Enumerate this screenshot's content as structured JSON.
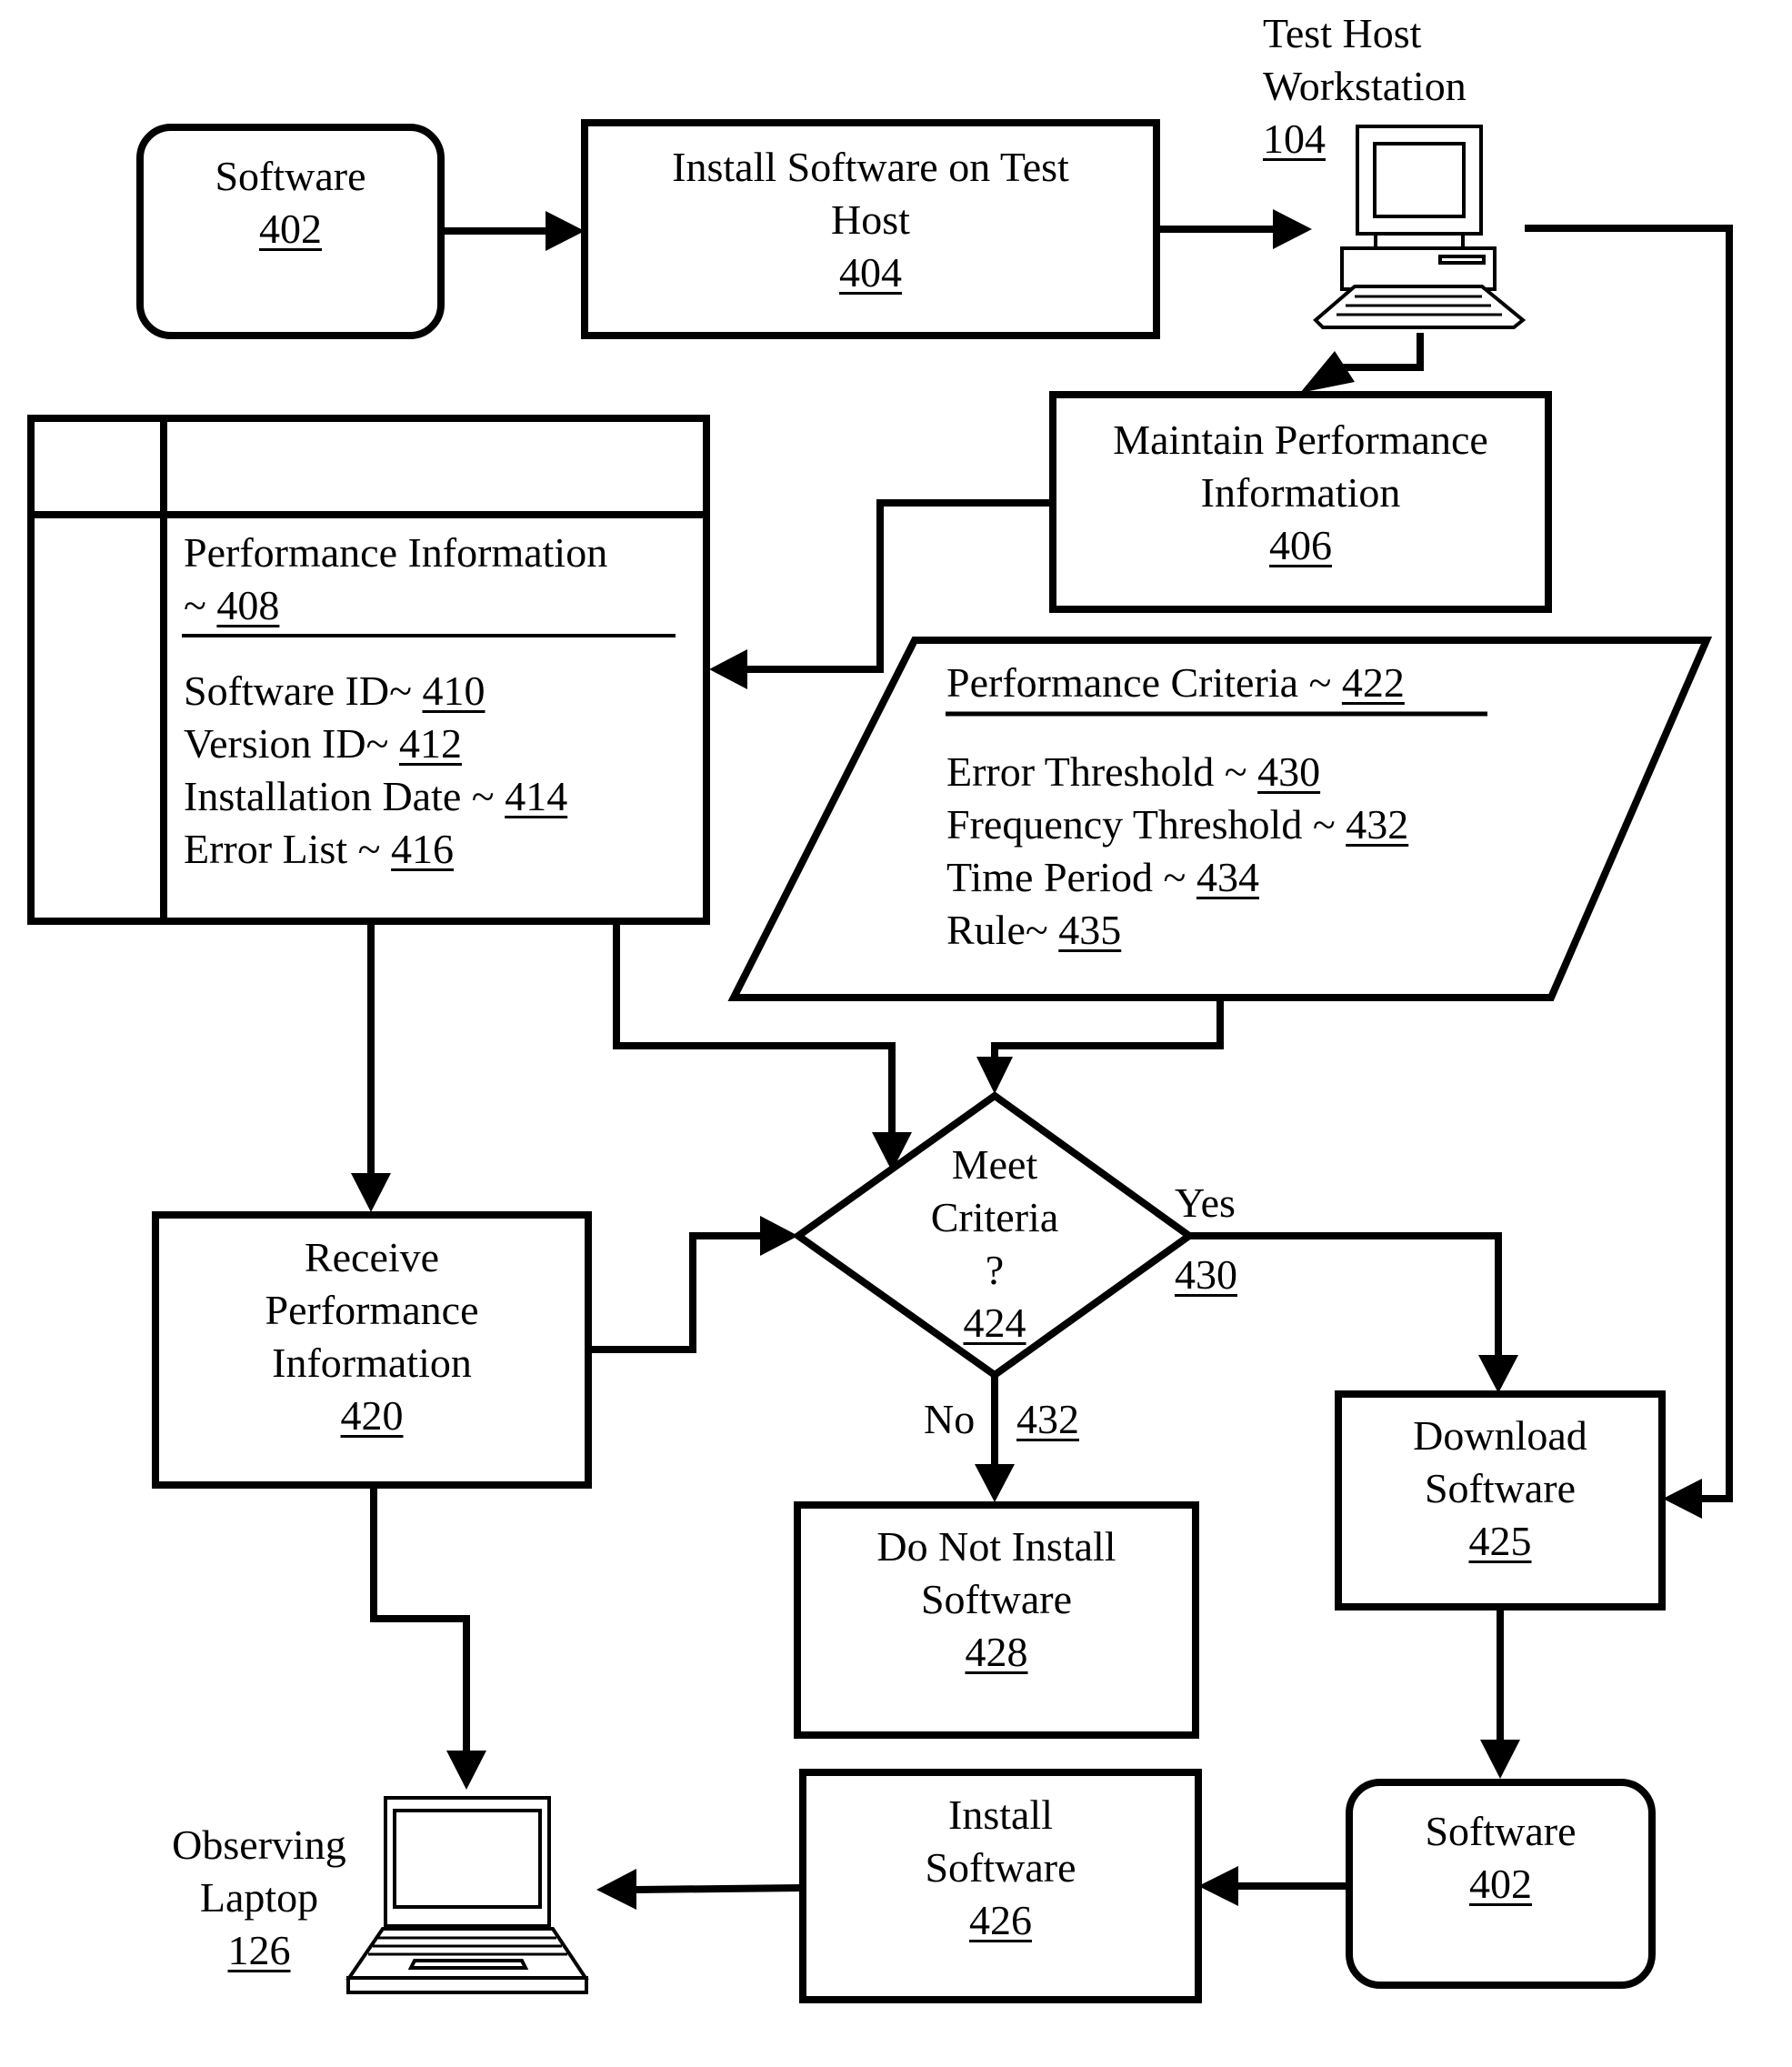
{
  "figure": {
    "colors": {
      "ink": "#000000",
      "paper": "#ffffff"
    },
    "nodes": {
      "software_top": {
        "label": "Software",
        "ref": "402",
        "shape": "rounded-rectangle"
      },
      "install_on_test_host": {
        "label_lines": [
          "Install Software on Test",
          "Host"
        ],
        "ref": "404",
        "shape": "rectangle"
      },
      "test_host_workstation": {
        "label_lines": [
          "Test Host",
          "Workstation"
        ],
        "ref": "104",
        "icon": "desktop-computer-icon"
      },
      "maintain_performance": {
        "label_lines": [
          "Maintain Performance",
          "Information"
        ],
        "ref": "406",
        "shape": "rectangle"
      },
      "performance_information": {
        "title": "Performance Information",
        "title_prefix": "~ ",
        "ref": "408",
        "shape": "table-record",
        "fields": [
          {
            "label": "Software ID~ ",
            "ref": "410"
          },
          {
            "label": "Version ID~ ",
            "ref": "412"
          },
          {
            "label": "Installation Date ~ ",
            "ref": "414"
          },
          {
            "label": "Error List ~ ",
            "ref": "416"
          }
        ]
      },
      "performance_criteria": {
        "title": "Performance Criteria ~ ",
        "ref": "422",
        "shape": "parallelogram",
        "fields": [
          {
            "label": "Error Threshold ~ ",
            "ref": "430"
          },
          {
            "label": "Frequency Threshold ~ ",
            "ref": "432"
          },
          {
            "label": "Time Period ~ ",
            "ref": "434"
          },
          {
            "label": "Rule~ ",
            "ref": "435"
          }
        ]
      },
      "meet_criteria": {
        "label_lines": [
          "Meet",
          "Criteria",
          "?"
        ],
        "ref": "424",
        "shape": "diamond"
      },
      "receive_performance": {
        "label_lines": [
          "Receive",
          "Performance",
          "Information"
        ],
        "ref": "420",
        "shape": "rectangle"
      },
      "download_software": {
        "label_lines": [
          "Download",
          "Software"
        ],
        "ref": "425",
        "shape": "rectangle"
      },
      "do_not_install": {
        "label_lines": [
          "Do Not Install",
          "Software"
        ],
        "ref": "428",
        "shape": "rectangle"
      },
      "install_software": {
        "label_lines": [
          "Install",
          "Software"
        ],
        "ref": "426",
        "shape": "rectangle"
      },
      "software_bottom": {
        "label": "Software",
        "ref": "402",
        "shape": "rounded-rectangle"
      },
      "observing_laptop": {
        "label_lines": [
          "Observing",
          "Laptop"
        ],
        "ref": "126",
        "icon": "laptop-computer-icon"
      }
    },
    "edges": {
      "yes": {
        "label": "Yes",
        "ref": "430"
      },
      "no": {
        "label": "No",
        "ref": "432"
      }
    }
  }
}
